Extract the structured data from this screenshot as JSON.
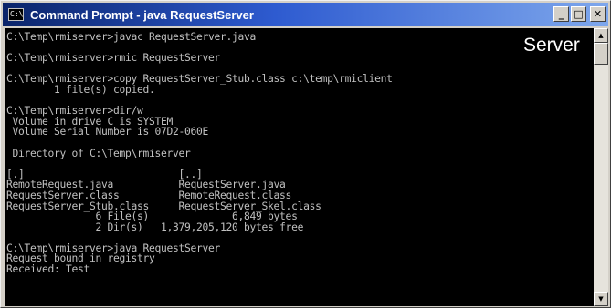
{
  "window": {
    "title": "Command Prompt - java RequestServer",
    "icon_text": "C:\\",
    "minimize_label": "_",
    "maximize_label": "□",
    "close_label": "✕"
  },
  "overlay_label": "Server",
  "console_lines": [
    "C:\\Temp\\rmiserver>javac RequestServer.java",
    "",
    "C:\\Temp\\rmiserver>rmic RequestServer",
    "",
    "C:\\Temp\\rmiserver>copy RequestServer_Stub.class c:\\temp\\rmiclient",
    "        1 file(s) copied.",
    "",
    "C:\\Temp\\rmiserver>dir/w",
    " Volume in drive C is SYSTEM",
    " Volume Serial Number is 07D2-060E",
    "",
    " Directory of C:\\Temp\\rmiserver",
    "",
    "[.]                          [..]",
    "RemoteRequest.java           RequestServer.java",
    "RequestServer.class          RemoteRequest.class",
    "RequestServer_Stub.class     RequestServer_Skel.class",
    "               6 File(s)              6,849 bytes",
    "               2 Dir(s)   1,379,205,120 bytes free",
    "",
    "C:\\Temp\\rmiserver>java RequestServer",
    "Request bound in registry",
    "Received: Test"
  ],
  "scrollbar": {
    "up_arrow": "▲",
    "down_arrow": "▼"
  },
  "colors": {
    "console_bg": "#000000",
    "console_fg": "#c0c0c0",
    "titlebar_start": "#0a246a",
    "titlebar_end": "#7ea7ec"
  }
}
